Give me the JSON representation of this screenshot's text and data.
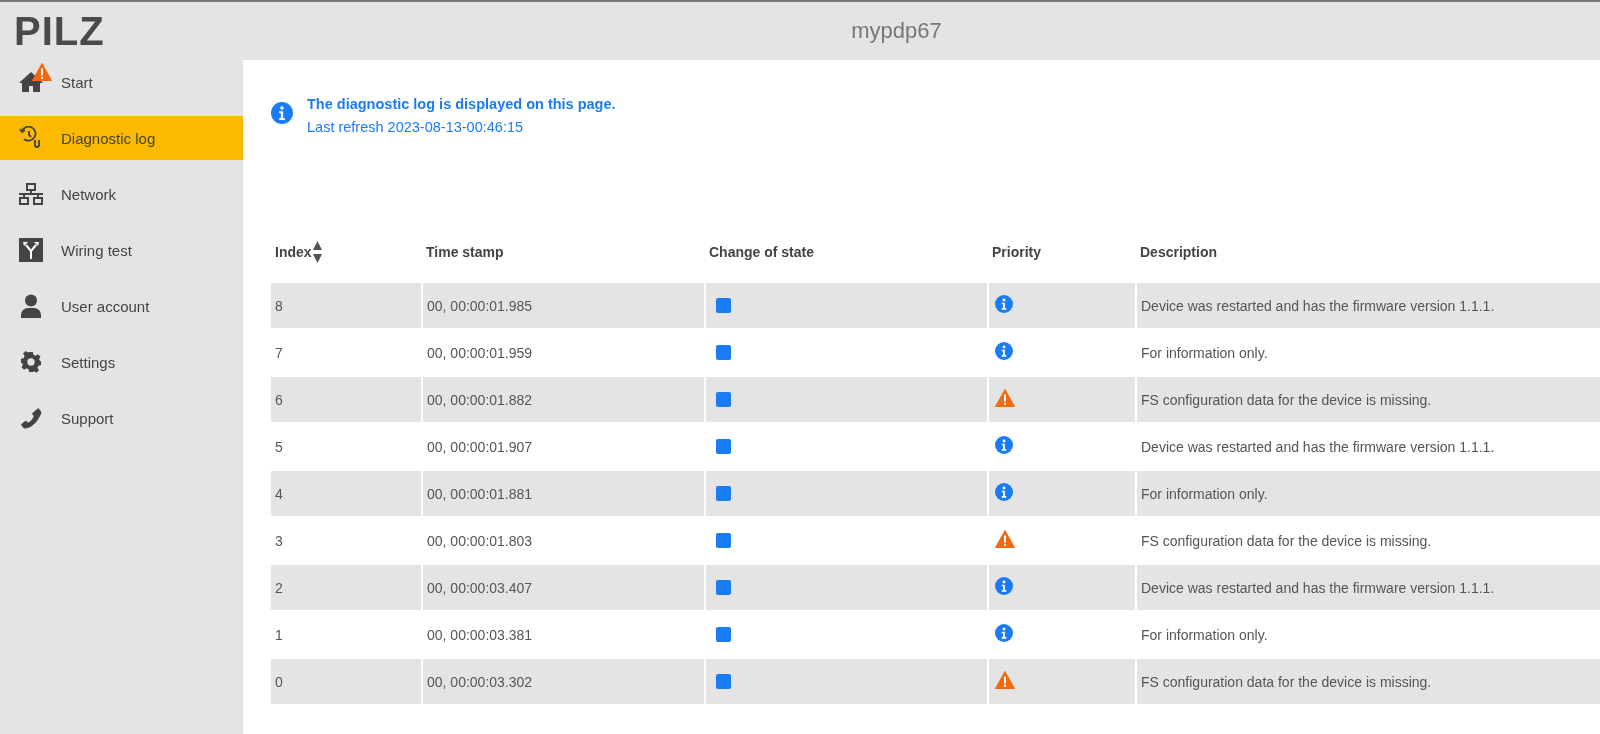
{
  "header": {
    "logo": "PILZ",
    "device_name": "mypdp67"
  },
  "sidebar": {
    "items": [
      {
        "label": "Start",
        "warning": true,
        "selected": false
      },
      {
        "label": "Diagnostic log",
        "warning": false,
        "selected": true
      },
      {
        "label": "Network",
        "warning": false,
        "selected": false
      },
      {
        "label": "Wiring test",
        "warning": false,
        "selected": false
      },
      {
        "label": "User account",
        "warning": false,
        "selected": false
      },
      {
        "label": "Settings",
        "warning": false,
        "selected": false
      },
      {
        "label": "Support",
        "warning": false,
        "selected": false
      }
    ]
  },
  "info": {
    "message": "The diagnostic log is displayed on this page.",
    "last_refresh": "Last refresh 2023-08-13-00:46:15"
  },
  "table": {
    "columns": [
      "Index",
      "Time stamp",
      "Change of state",
      "Priority",
      "Description"
    ],
    "rows": [
      {
        "index": "8",
        "time": "00, 00:00:01.985",
        "kind": "info",
        "description": "Device was restarted and has the firmware version 1.1.1."
      },
      {
        "index": "7",
        "time": "00, 00:00:01.959",
        "kind": "info",
        "description": "For information only."
      },
      {
        "index": "6",
        "time": "00, 00:00:01.882",
        "kind": "warning",
        "description": "FS configuration data for the device is missing."
      },
      {
        "index": "5",
        "time": "00, 00:00:01.907",
        "kind": "info",
        "description": "Device was restarted and has the firmware version 1.1.1."
      },
      {
        "index": "4",
        "time": "00, 00:00:01.881",
        "kind": "info",
        "description": "For information only."
      },
      {
        "index": "3",
        "time": "00, 00:00:01.803",
        "kind": "warning",
        "description": "FS configuration data for the device is missing."
      },
      {
        "index": "2",
        "time": "00, 00:00:03.407",
        "kind": "info",
        "description": "Device was restarted and has the firmware version 1.1.1."
      },
      {
        "index": "1",
        "time": "00, 00:00:03.381",
        "kind": "info",
        "description": "For information only."
      },
      {
        "index": "0",
        "time": "00, 00:00:03.302",
        "kind": "warning",
        "description": "FS configuration data for the device is missing."
      }
    ]
  }
}
